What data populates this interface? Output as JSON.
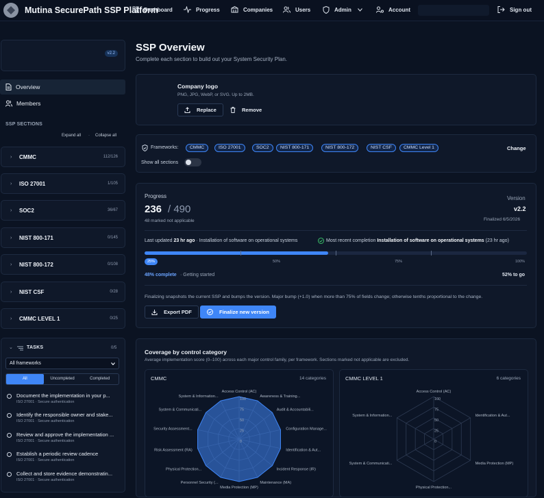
{
  "app": {
    "title": "Mutina SecurePath SSP Platform",
    "nav": [
      "Dashboard",
      "Progress",
      "Companies",
      "Users",
      "Admin",
      "Account",
      "Sign out"
    ]
  },
  "sidebar": {
    "version_badge": "v2.2",
    "links": [
      "Overview",
      "Members"
    ],
    "sections_heading": "SSP SECTIONS",
    "expand_all": "Expand all",
    "collapse_all": "Collapse all",
    "frameworks": [
      {
        "name": "CMMC",
        "count": "112/126"
      },
      {
        "name": "ISO 27001",
        "count": "1/105"
      },
      {
        "name": "SOC2",
        "count": "36/67"
      },
      {
        "name": "NIST 800-171",
        "count": "0/145"
      },
      {
        "name": "NIST 800-172",
        "count": "0/108"
      },
      {
        "name": "NIST CSF",
        "count": "0/28"
      },
      {
        "name": "CMMC LEVEL 1",
        "count": "0/25"
      }
    ],
    "tasks": {
      "heading": "TASKS",
      "count": "0/5",
      "filter": "All frameworks",
      "segments": [
        "All",
        "Uncompleted",
        "Completed"
      ],
      "items": [
        {
          "title": "Document the implementation in your p...",
          "sub": "ISO 27001 · Secure authentication"
        },
        {
          "title": "Identify the responsible owner and stake...",
          "sub": "ISO 27001 · Secure authentication"
        },
        {
          "title": "Review and approve the implementation ...",
          "sub": "ISO 27001 · Secure authentication"
        },
        {
          "title": "Establish a periodic review cadence",
          "sub": "ISO 27001 · Secure authentication"
        },
        {
          "title": "Collect and store evidence demonstratin...",
          "sub": "ISO 27001 · Secure authentication"
        }
      ]
    }
  },
  "main": {
    "title": "SSP Overview",
    "subtitle": "Complete each section to build out your System Security Plan.",
    "logo": {
      "title": "Company logo",
      "hint": "PNG, JPG, WebP, or SVG. Up to 2MB.",
      "replace": "Replace",
      "remove": "Remove"
    },
    "frameworks": {
      "label": "Frameworks:",
      "chips": [
        "CMMC",
        "ISO 27001",
        "SOC2",
        "NIST 800-171",
        "NIST 800-172",
        "NIST CSF",
        "CMMC Level 1"
      ],
      "change": "Change",
      "show_all": "Show all sections"
    },
    "progress": {
      "label": "Progress",
      "done": "236",
      "total": "/ 490",
      "na": "48 marked not applicable",
      "version_label": "Version",
      "version": "v2.2",
      "finalized": "Finalized 6/5/2026",
      "updated_prefix": "Last updated",
      "updated_ago": "23 hr ago",
      "updated_item": "· Installation of software on operational systems",
      "recent_label": "Most recent completion",
      "recent_item": "Installation of software on operational systems",
      "recent_ago": "(23 hr ago)",
      "percent": 48,
      "markers": [
        "25%",
        "50%",
        "75%",
        "100%"
      ],
      "complete_text": "48% complete",
      "status_text": "· Getting started",
      "to_go": "52% to go",
      "note": "Finalizing snapshots the current SSP and bumps the version. Major bump (+1.0) when more than 75% of fields change; otherwise tenths proportional to the change.",
      "export": "Export PDF",
      "finalize": "Finalize new version"
    },
    "coverage": {
      "title": "Coverage by control category",
      "subtitle": "Average implementation score (0–100) across each major control family, per framework. Sections marked not applicable are excluded."
    }
  },
  "chart_data": [
    {
      "type": "radar",
      "title": "CMMC",
      "subtitle": "14 categories",
      "categories": [
        "Access Control (AC)",
        "Awareness & Training...",
        "Audit & Accountabili...",
        "Configuration Manage...",
        "Identification & Aut...",
        "Incident Response (IR)",
        "Maintenance (MA)",
        "Media Protection (MP)",
        "Personnel Security (...",
        "Physical Protection...",
        "Risk Assessment (RA)",
        "Security Assessment...",
        "System & Communicati...",
        "System & Information..."
      ],
      "ticks": [
        "0",
        "25",
        "50",
        "75",
        "100"
      ],
      "ylim": [
        0,
        100
      ],
      "values": [
        100,
        100,
        100,
        100,
        100,
        100,
        100,
        100,
        100,
        100,
        100,
        100,
        100,
        100
      ]
    },
    {
      "type": "radar",
      "title": "CMMC LEVEL 1",
      "subtitle": "6 categories",
      "categories": [
        "Access Control (AC)",
        "Identification & Aut...",
        "Media Protection (MP)",
        "Physical Protection...",
        "System & Communicati...",
        "System & Information..."
      ],
      "ticks": [
        "0",
        "25",
        "50",
        "75",
        "100"
      ],
      "ylim": [
        0,
        100
      ],
      "values": [
        0,
        0,
        0,
        0,
        0,
        0
      ]
    }
  ]
}
